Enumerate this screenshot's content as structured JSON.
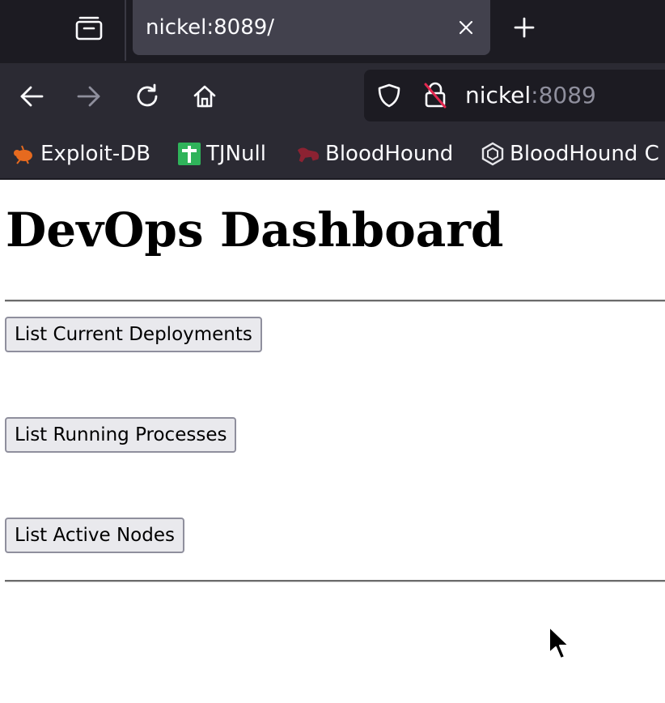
{
  "browser": {
    "tab": {
      "title": "nickel:8089/",
      "close_icon": "close-icon"
    },
    "new_tab_icon": "plus-icon",
    "nav": {
      "back_icon": "arrow-left-icon",
      "forward_icon": "arrow-right-icon",
      "reload_icon": "reload-icon",
      "home_icon": "home-icon"
    },
    "url": {
      "host": "nickel",
      "port": ":8089"
    },
    "bookmarks": [
      {
        "label": "Exploit-DB",
        "icon": "bug-icon"
      },
      {
        "label": "TJNull",
        "icon": "cross-icon"
      },
      {
        "label": "BloodHound",
        "icon": "hound-icon"
      },
      {
        "label": "BloodHound C",
        "icon": "hexagon-icon"
      }
    ]
  },
  "page": {
    "title": "DevOps Dashboard",
    "buttons": [
      {
        "label": "List Current Deployments"
      },
      {
        "label": "List Running Processes"
      },
      {
        "label": "List Active Nodes"
      }
    ]
  },
  "colors": {
    "tabstrip": "#1c1b22",
    "toolbar": "#2b2a33",
    "active_tab": "#42414d",
    "button_bg": "#e9e9ed"
  }
}
